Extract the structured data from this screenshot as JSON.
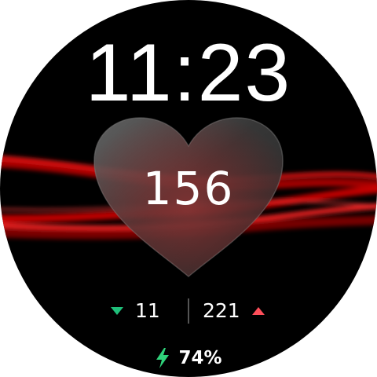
{
  "watch_face": {
    "time": "11:23",
    "heart_rate": "156",
    "min_heart_rate": "11",
    "max_heart_rate": "221",
    "battery": "74%"
  },
  "icons": {
    "min_indicator": "triangle-down-icon",
    "max_indicator": "triangle-up-icon",
    "battery_indicator": "lightning-bolt-icon",
    "heart_shape": "heart-icon"
  },
  "colors": {
    "background": "#000000",
    "wave_red": "#ff1a1a",
    "min_green": "#1fbf7a",
    "max_red": "#ff4f5a",
    "battery_green": "#2fd27a"
  }
}
